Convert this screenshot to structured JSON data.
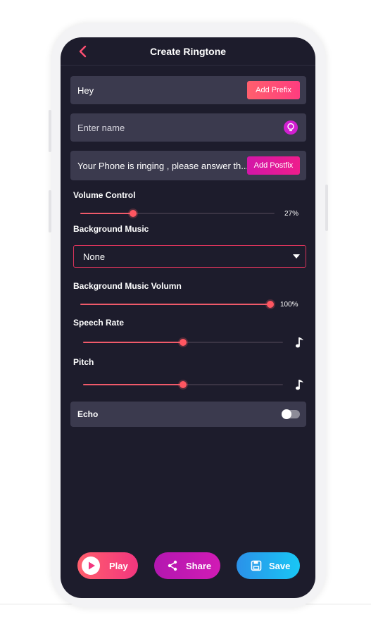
{
  "header": {
    "title": "Create Ringtone",
    "back_icon": "back-arrow-icon"
  },
  "prefix_field": {
    "value": "Hey",
    "button_label": "Add Prefix"
  },
  "name_field": {
    "placeholder": "Enter name",
    "icon": "bulb-icon"
  },
  "postfix_field": {
    "value": "Your Phone is ringing , please answer th...",
    "button_label": "Add Postfix"
  },
  "volume": {
    "label": "Volume Control",
    "value": 27,
    "display": "27%"
  },
  "background_music": {
    "label": "Background Music",
    "selected": "None"
  },
  "bg_music_volume": {
    "label": "Background Music Volumn",
    "value": 100,
    "display": "100%"
  },
  "speech_rate": {
    "label": "Speech Rate",
    "value": 50,
    "icon": "music-note-icon"
  },
  "pitch": {
    "label": "Pitch",
    "value": 50,
    "icon": "music-note-icon"
  },
  "echo": {
    "label": "Echo",
    "enabled": false
  },
  "actions": {
    "play": "Play",
    "share": "Share",
    "save": "Save"
  },
  "colors": {
    "background": "#1d1c2c",
    "card": "#3b3a4e",
    "accent": "#ff5661",
    "save_accent": "#19c7f4"
  }
}
